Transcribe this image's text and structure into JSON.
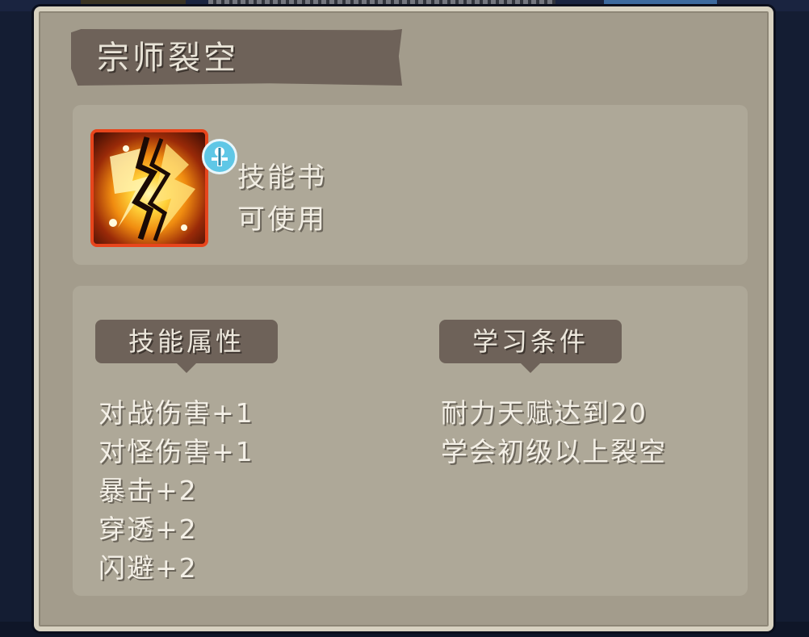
{
  "item": {
    "name": "宗师裂空",
    "type": "技能书",
    "usable": "可使用",
    "icon": "lightning-crack-icon",
    "badge_icon": "class-badge-icon"
  },
  "sections": {
    "attributes": {
      "label": "技能属性",
      "entries": [
        "对战伤害+1",
        "对怪伤害+1",
        "暴击+2",
        "穿透+2",
        "闪避+2"
      ]
    },
    "requirements": {
      "label": "学习条件",
      "entries": [
        "耐力天赋达到20",
        "学会初级以上裂空"
      ]
    }
  },
  "colors": {
    "dialog_bg": "#a39c8c",
    "panel_bg": "#aea898",
    "banner_bg": "#6e6259",
    "icon_border": "#e7451c",
    "badge": "#5fc7e6"
  }
}
